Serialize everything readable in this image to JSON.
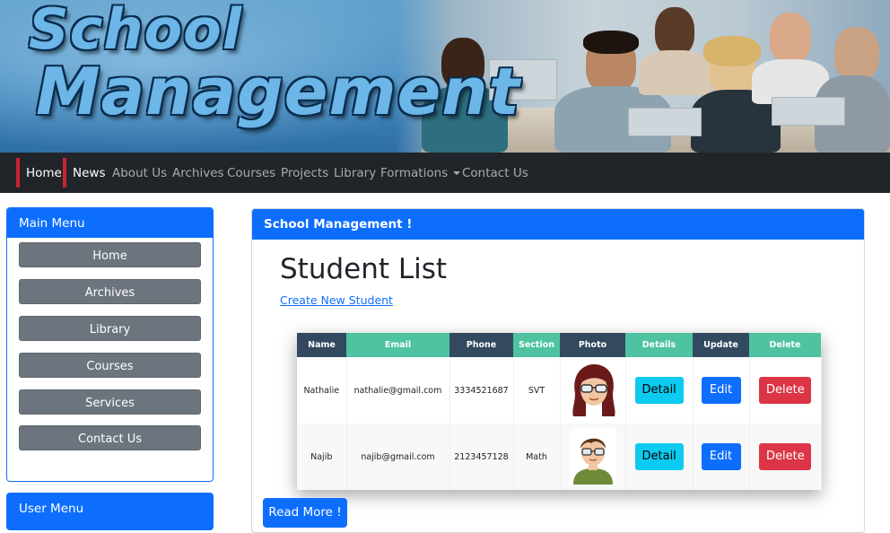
{
  "header": {
    "logo_line1": "School",
    "logo_line2": "Management"
  },
  "navbar": {
    "items": [
      {
        "label": "Home",
        "active": true
      },
      {
        "label": "News",
        "active": true
      },
      {
        "label": "About Us",
        "active": false
      },
      {
        "label": "Archives",
        "active": false
      },
      {
        "label": "Courses",
        "active": false
      },
      {
        "label": "Projects",
        "active": false
      },
      {
        "label": "Library",
        "active": false
      },
      {
        "label": "Formations",
        "active": false,
        "dropdown": true
      },
      {
        "label": "Contact Us",
        "active": false
      }
    ],
    "accent_color": "#c82333"
  },
  "sidebar": {
    "main_menu_title": "Main Menu",
    "items": [
      {
        "label": "Home"
      },
      {
        "label": "Archives"
      },
      {
        "label": "Library"
      },
      {
        "label": "Courses"
      },
      {
        "label": "Services"
      },
      {
        "label": "Contact Us"
      }
    ],
    "user_menu_title": "User Menu"
  },
  "main": {
    "card_title": "School Management !",
    "page_title": "Student List",
    "create_link": "Create New Student",
    "read_more": "Read More !",
    "table": {
      "headers": [
        "Name",
        "Email",
        "Phone",
        "Section",
        "Photo",
        "Details",
        "Update",
        "Delete"
      ],
      "rows": [
        {
          "name": "Nathalie",
          "email": "nathalie@gmail.com",
          "phone": "3334521687",
          "section": "SVT",
          "photo": "female-avatar-icon",
          "detail": "Detail",
          "edit": "Edit",
          "delete": "Delete"
        },
        {
          "name": "Najib",
          "email": "najib@gmail.com",
          "phone": "2123457128",
          "section": "Math",
          "photo": "male-avatar-icon",
          "detail": "Detail",
          "edit": "Edit",
          "delete": "Delete"
        }
      ]
    }
  },
  "colors": {
    "primary": "#0d6efd",
    "navbar_bg": "#212529",
    "header_dark": "#324960",
    "header_green": "#4fc3a1",
    "detail_btn": "#0dcaf0",
    "delete_btn": "#dc3545",
    "sidebar_btn": "#6c757d"
  }
}
